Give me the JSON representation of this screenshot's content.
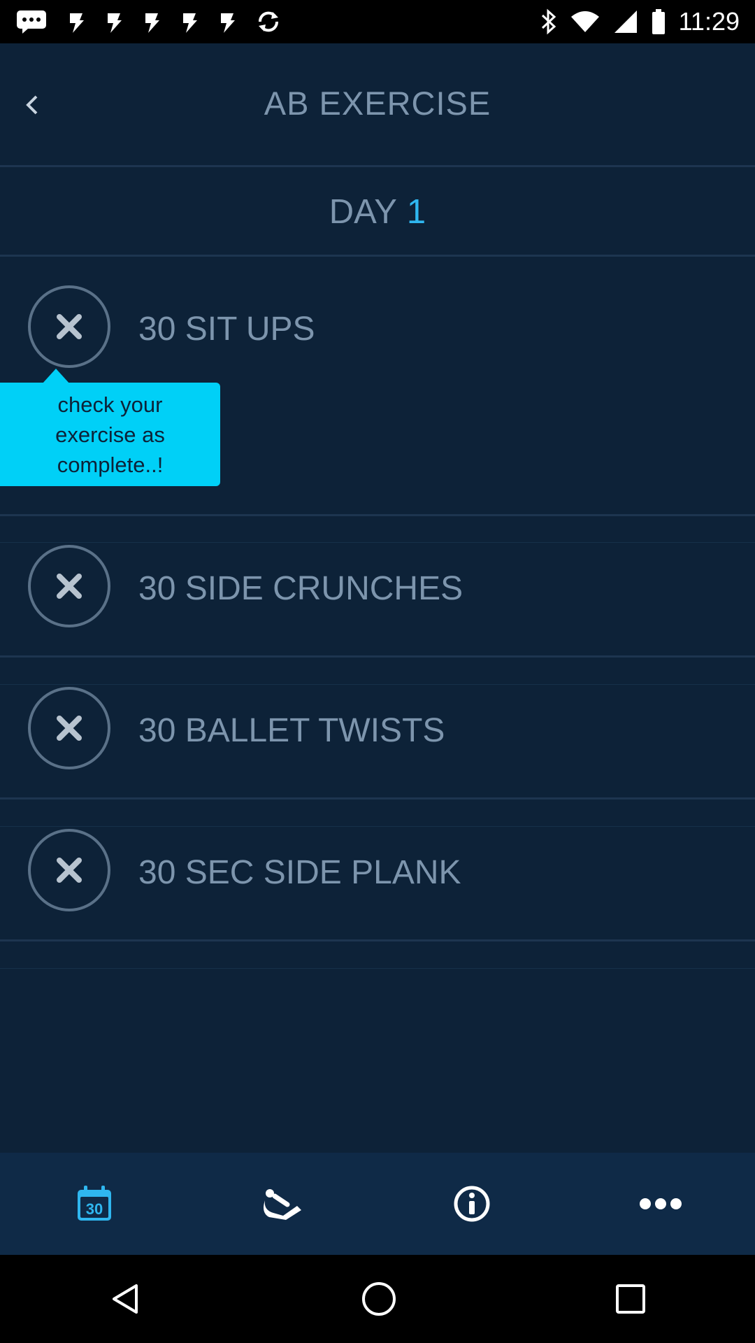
{
  "status_bar": {
    "time": "11:29",
    "left_icons": [
      "messages-icon",
      "lightning-icon",
      "lightning-icon",
      "lightning-icon",
      "lightning-icon",
      "lightning-icon",
      "sync-icon"
    ],
    "right_icons": [
      "bluetooth-icon",
      "wifi-icon",
      "signal-icon",
      "battery-icon"
    ]
  },
  "header": {
    "title": "AB EXERCISE",
    "back_icon": "back-chevron-icon"
  },
  "day": {
    "label": "DAY",
    "number": "1"
  },
  "exercises": [
    {
      "label": "30 SIT UPS",
      "completed": false
    },
    {
      "label": "30 SIDE CRUNCHES",
      "completed": false
    },
    {
      "label": "30 BALLET TWISTS",
      "completed": false
    },
    {
      "label": "30 SEC SIDE PLANK",
      "completed": false
    }
  ],
  "tooltip": {
    "line1": "check your",
    "line2": "exercise as",
    "line3": "complete..!"
  },
  "bottom_nav": {
    "items": [
      {
        "icon": "calendar-icon",
        "calendar_number": "30",
        "active": true
      },
      {
        "icon": "exercise-icon",
        "active": false
      },
      {
        "icon": "info-icon",
        "active": false
      },
      {
        "icon": "more-icon",
        "active": false
      }
    ]
  },
  "colors": {
    "background": "#0d2238",
    "text_muted": "#7d95ad",
    "accent": "#2fb7f0",
    "tooltip": "#00d0f7",
    "nav_bar": "#0f2a47"
  }
}
